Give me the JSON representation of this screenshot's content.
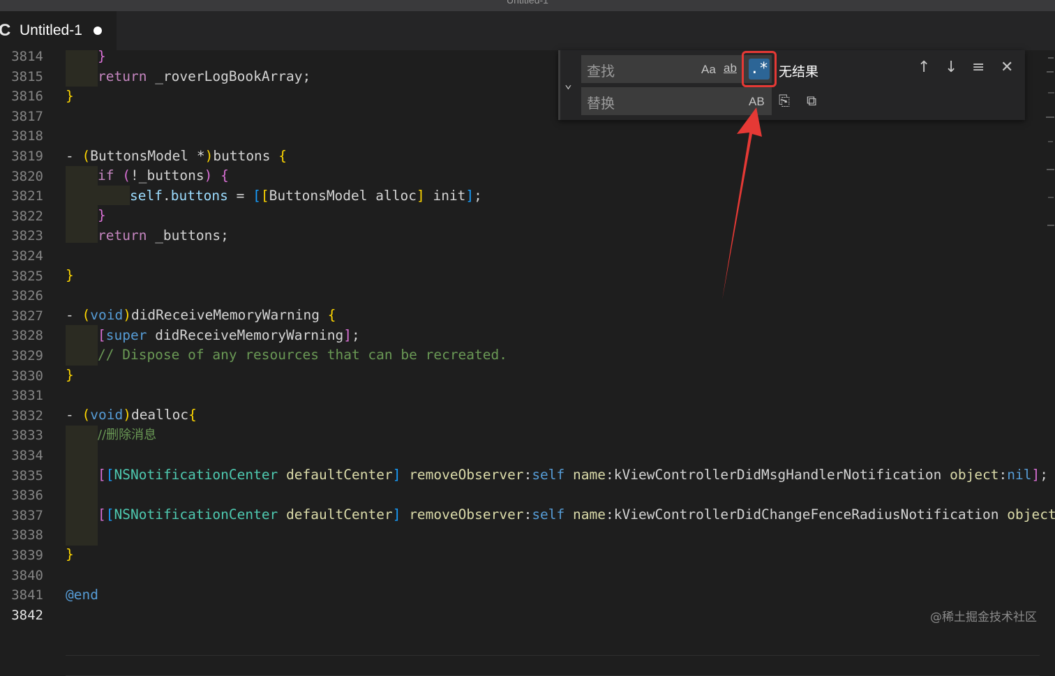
{
  "window": {
    "title": "Untitled-1"
  },
  "tab": {
    "lang_icon": "C",
    "name": "Untitled-1",
    "dirty": true
  },
  "find_widget": {
    "find_placeholder": "查找",
    "replace_placeholder": "替换",
    "match_case": "Aa",
    "whole_word": "ab",
    "regex": ".*",
    "preserve_case": "AB",
    "status": "无结果",
    "prev_icon": "arrow-up-icon",
    "next_icon": "arrow-down-icon",
    "selection_icon": "find-in-selection-icon",
    "close_icon": "close-icon"
  },
  "gutter": [
    "3814",
    "3815",
    "3816",
    "3817",
    "3818",
    "3819",
    "3820",
    "3821",
    "3822",
    "3823",
    "3824",
    "3825",
    "3826",
    "3827",
    "3828",
    "3829",
    "3830",
    "3831",
    "3832",
    "3833",
    "3834",
    "3835",
    "3836",
    "3837",
    "3838",
    "3839",
    "3840",
    "3841",
    "3842"
  ],
  "code": {
    "l3814": "}",
    "l3815": "return _roverLogBookArray;",
    "l3816": "}",
    "l3819": "- (ButtonsModel *)buttons {",
    "l3820": "if (!_buttons) {",
    "l3821": "self.buttons = [[ButtonsModel alloc] init];",
    "l3822": "}",
    "l3823": "return _buttons;",
    "l3825": "}",
    "l3827": "- (void)didReceiveMemoryWarning {",
    "l3828": "[super didReceiveMemoryWarning];",
    "l3829": "// Dispose of any resources that can be recreated.",
    "l3830": "}",
    "l3832": "- (void)dealloc{",
    "l3833": "//删除消息",
    "l3835": "[[NSNotificationCenter defaultCenter] removeObserver:self name:kViewControllerDidMsgHandlerNotification object:nil];",
    "l3837": "[[NSNotificationCenter defaultCenter] removeObserver:self name:kViewControllerDidChangeFenceRadiusNotification object:",
    "l3839": "}",
    "l3841": "@end"
  },
  "watermark": "@稀土掘金技术社区",
  "colors": {
    "annotation": "#e53935",
    "regex_active": "#2c6596"
  }
}
